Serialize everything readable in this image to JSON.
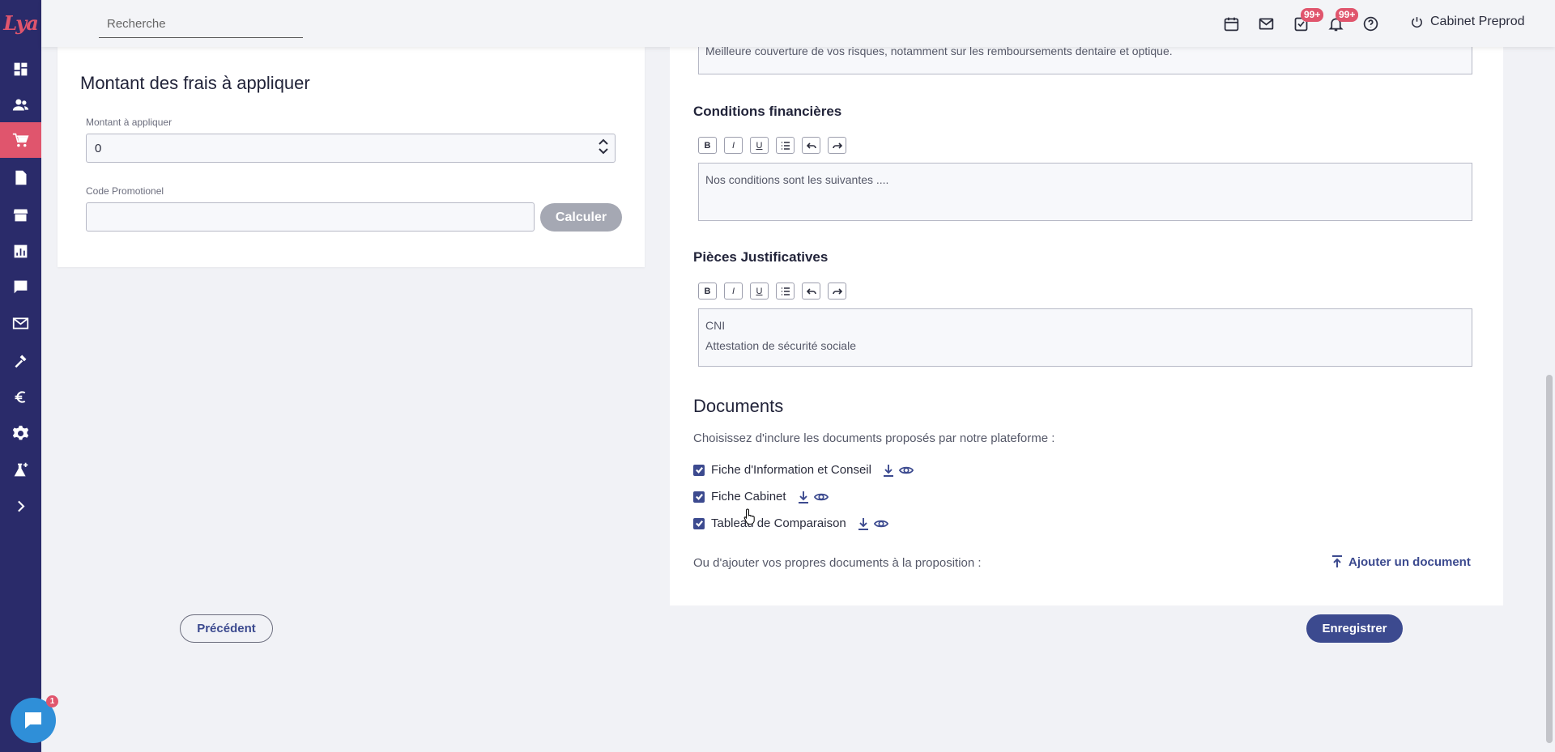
{
  "app": {
    "logo_text": "Lya"
  },
  "sidebar": {
    "items": [
      {
        "icon": "dashboard-icon",
        "active": false
      },
      {
        "icon": "users-icon",
        "active": false
      },
      {
        "icon": "cart-icon",
        "active": true
      },
      {
        "icon": "document-icon",
        "active": false
      },
      {
        "icon": "store-icon",
        "active": false
      },
      {
        "icon": "chart-icon",
        "active": false
      },
      {
        "icon": "message-icon",
        "active": false
      },
      {
        "icon": "mail-icon",
        "active": false
      },
      {
        "icon": "tools-icon",
        "active": false
      },
      {
        "icon": "euro-icon",
        "active": false
      },
      {
        "icon": "gear-icon",
        "active": false
      },
      {
        "icon": "lab-icon",
        "active": false
      },
      {
        "icon": "chevron-right-icon",
        "active": false
      }
    ]
  },
  "topbar": {
    "search_placeholder": "Recherche",
    "tasks_badge": "99+",
    "notifications_badge": "99+",
    "user_name": "Cabinet Preprod"
  },
  "fees": {
    "title": "Montant des frais à appliquer",
    "amount_label": "Montant à appliquer",
    "amount_value": "0",
    "promo_label": "Code Promotionel",
    "promo_value": "",
    "calculate_button": "Calculer"
  },
  "proposal": {
    "top_editor_text": "Meilleure couverture de vos risques, notamment sur les remboursements dentaire et optique.",
    "financial_title": "Conditions financières",
    "financial_text": "Nos conditions sont les suivantes ....",
    "supporting_title": "Pièces Justificatives",
    "supporting_lines": [
      "CNI",
      "Attestation de sécurité sociale"
    ],
    "toolbar": [
      "B",
      "I",
      "U",
      "list",
      "undo",
      "redo"
    ]
  },
  "documents": {
    "title": "Documents",
    "description": "Choisissez d'inclure les documents proposés par notre plateforme :",
    "items": [
      {
        "label": "Fiche d'Information et Conseil",
        "checked": true
      },
      {
        "label": "Fiche Cabinet",
        "checked": true
      },
      {
        "label": "Tableau de Comparaison",
        "checked": true
      }
    ],
    "own_docs_text": "Ou d'ajouter vos propres documents à la proposition :",
    "add_document_button": "Ajouter un document"
  },
  "footer": {
    "previous_button": "Précédent",
    "save_button": "Enregistrer"
  },
  "chat": {
    "badge": "1"
  },
  "colors": {
    "sidebar": "#2a2b6a",
    "accent": "#e0556d",
    "primary": "#3c4a8f"
  }
}
